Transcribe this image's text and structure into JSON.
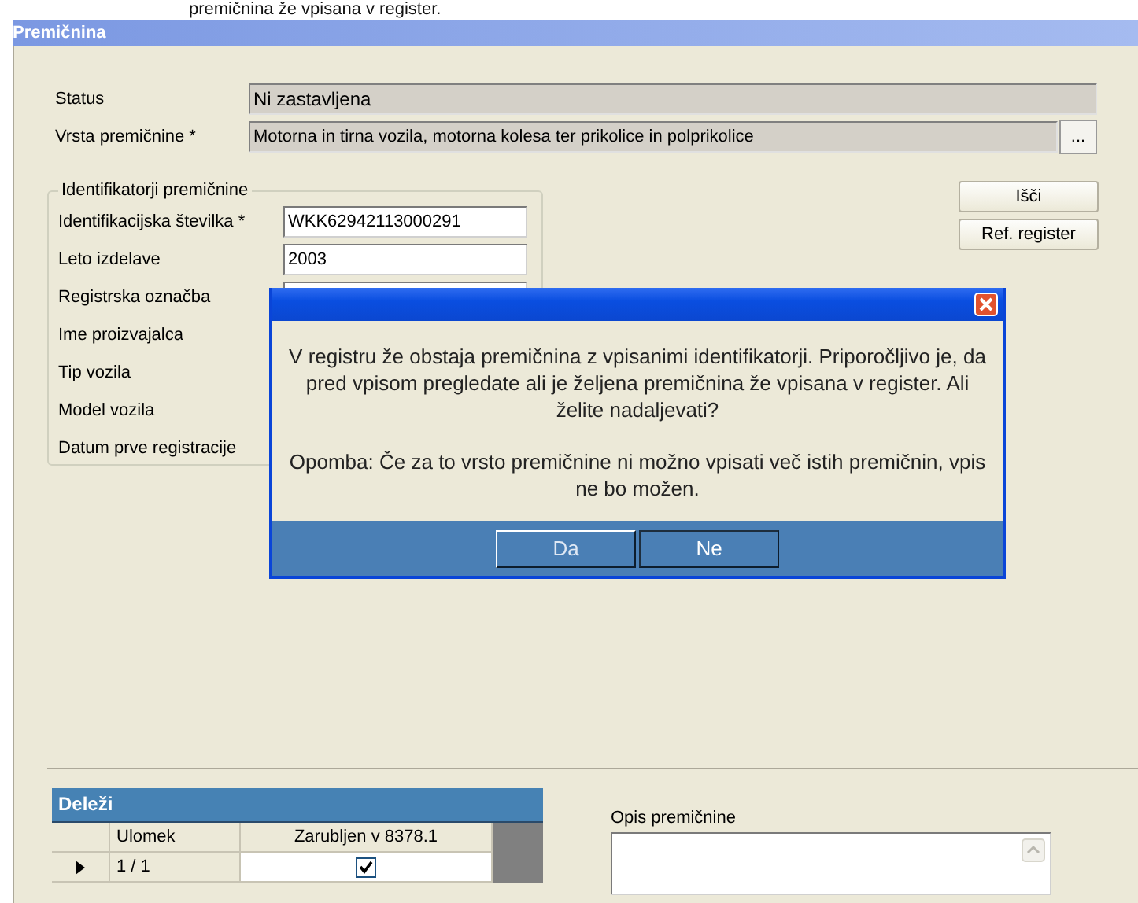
{
  "caption": "premičnina že vpisana v register.",
  "window": {
    "title": "Premičnina"
  },
  "status": {
    "label": "Status",
    "value": "Ni zastavljena"
  },
  "type": {
    "label": "Vrsta premičnine *",
    "value": "Motorna in tirna vozila, motorna kolesa ter prikolice in polprikolice",
    "button": "..."
  },
  "identifiers": {
    "title": "Identifikatorji premičnine",
    "fields": [
      {
        "kind": "field",
        "label": "Identifikacijska številka *",
        "value": "WKK62942113000291"
      },
      {
        "kind": "field",
        "label": "Leto izdelave",
        "value": "2003"
      },
      {
        "kind": "field",
        "label": "Registrska označba"
      },
      {
        "kind": "label",
        "label": "Ime proizvajalca"
      },
      {
        "kind": "label",
        "label": "Tip vozila"
      },
      {
        "kind": "label",
        "label": "Model vozila"
      },
      {
        "kind": "label",
        "label": "Datum prve registracije"
      }
    ]
  },
  "actions": [
    "Išči",
    "Ref. register"
  ],
  "dialog": {
    "message": "V registru že obstaja premičnina z vpisanimi identifikatorji. Priporočljivo je, da pred vpisom pregledate ali je željena premičnina že vpisana v register. Ali želite nadaljevati?",
    "note": "Opomba: Če za to vrsto premičnine ni možno vpisati več istih premičnin, vpis ne bo možen.",
    "buttons": [
      {
        "label": "Da",
        "selected": true
      },
      {
        "label": "Ne",
        "selected": false
      }
    ]
  },
  "shares": {
    "title": "Deleži",
    "columns": [
      "Ulomek",
      "Zarubljen v 8378.1"
    ],
    "rows": [
      {
        "current": true,
        "fraction": "1 / 1",
        "checked": true
      }
    ]
  },
  "description": {
    "label": "Opis premičnine"
  }
}
